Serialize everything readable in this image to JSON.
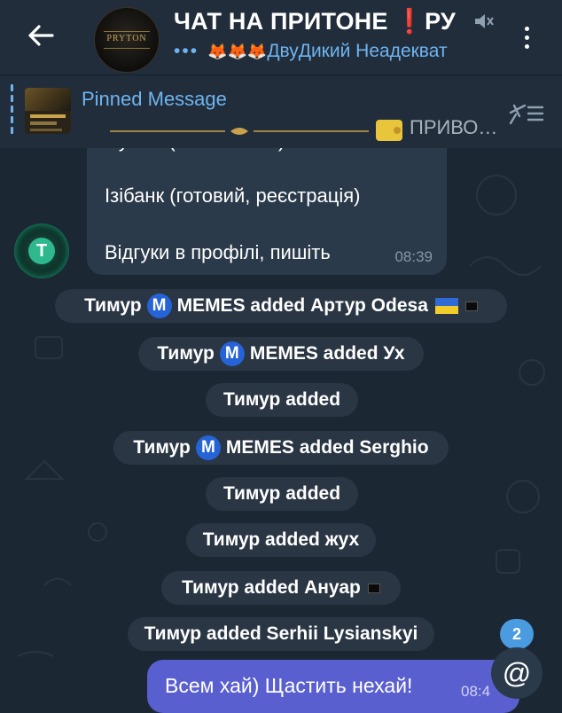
{
  "header": {
    "title_main": "ЧАТ НА ПРИТОНЕ ",
    "title_excl": "❗",
    "title_tail": "РУ",
    "avatar_text": "PRYTON",
    "subtitle_dots": "•••",
    "subtitle_emoji": "🦊🦊🦊",
    "subtitle_text": "ДвуДикий Неадекват"
  },
  "pinned": {
    "label": "Pinned Message",
    "text_right": "ПРИВО…"
  },
  "message": {
    "line1": "Нужно (готовий тех)",
    "line2": "Ізібанк (готовий, реєстрація)",
    "line3": "Відгуки в профілі, пишіть",
    "time": "08:39"
  },
  "service": [
    {
      "pre": "Тимур",
      "badge": "M",
      "post": "MEMES added Артур Odesa"
    },
    {
      "pre": "Тимур",
      "badge": "M",
      "post": "MEMES added Ух"
    },
    {
      "text": "Тимур added"
    },
    {
      "pre": "Тимур",
      "badge": "M",
      "post": "MEMES added Serghio"
    },
    {
      "text": "Тимур added"
    },
    {
      "text": "Тимур added жух"
    },
    {
      "text": "Тимур added Ануар"
    },
    {
      "text": "Тимур added Serhii Lysianskyi"
    }
  ],
  "outgoing": {
    "text": "Всем хай) Щастить нехай!",
    "time": "08:4"
  },
  "badges": {
    "unread_count": "2",
    "mention_symbol": "@"
  },
  "colors": {
    "background": "#1c2734",
    "header": "#212d3b",
    "accent": "#6fb4ef",
    "outgoing": "#5a5fd0",
    "service_pill": "#2a3644"
  }
}
